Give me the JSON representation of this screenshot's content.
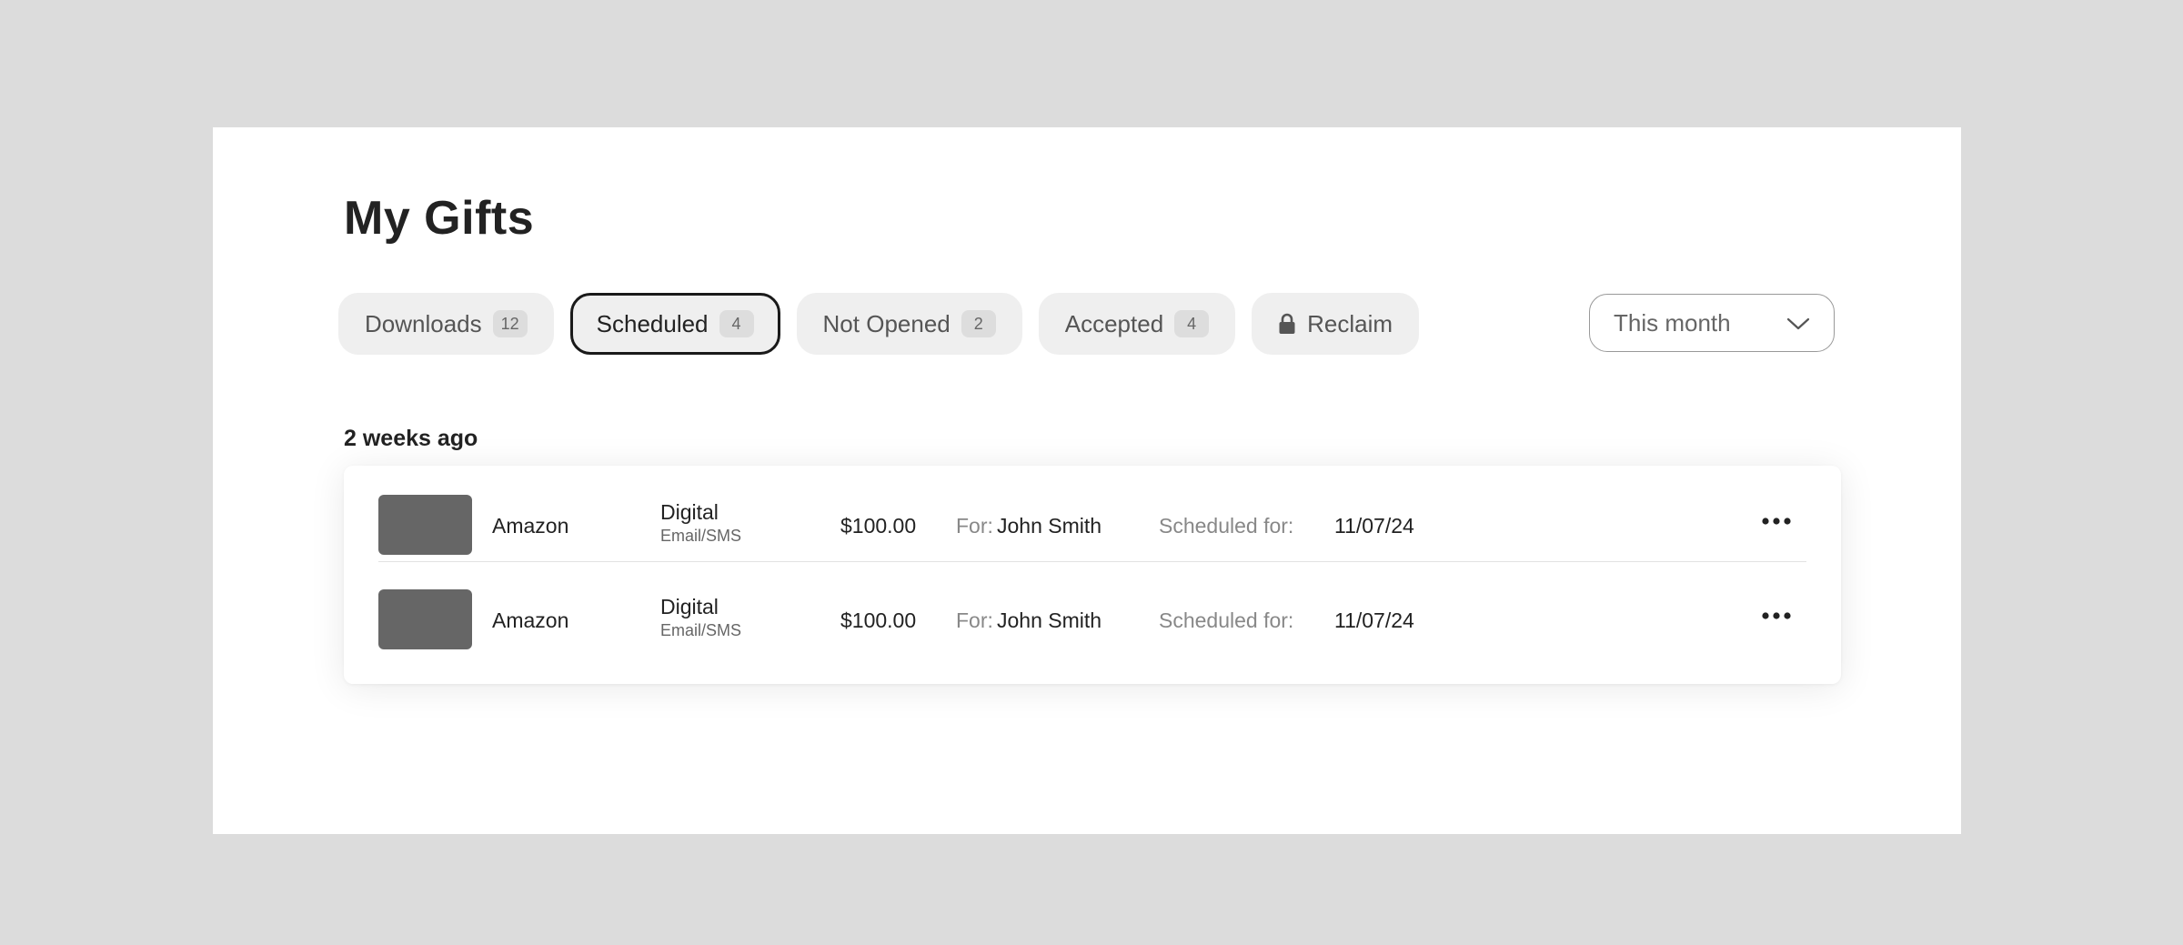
{
  "page": {
    "title": "My Gifts"
  },
  "tabs": [
    {
      "label": "Downloads",
      "count": "12",
      "active": false
    },
    {
      "label": "Scheduled",
      "count": "4",
      "active": true
    },
    {
      "label": "Not Opened",
      "count": "2",
      "active": false
    },
    {
      "label": "Accepted",
      "count": "4",
      "active": false
    },
    {
      "label": "Reclaim",
      "icon": "lock-icon",
      "active": false
    }
  ],
  "filter": {
    "selected": "This month",
    "icon": "chevron-down-icon"
  },
  "section": {
    "label": "2 weeks ago"
  },
  "gifts": [
    {
      "brand": "Amazon",
      "type": "Digital",
      "delivery": "Email/SMS",
      "amount": "$100.00",
      "for_label": "For:",
      "recipient": "John Smith",
      "scheduled_label": "Scheduled for:",
      "scheduled_date": "11/07/24"
    },
    {
      "brand": "Amazon",
      "type": "Digital",
      "delivery": "Email/SMS",
      "amount": "$100.00",
      "for_label": "For:",
      "recipient": "John Smith",
      "scheduled_label": "Scheduled for:",
      "scheduled_date": "11/07/24"
    }
  ],
  "colors": {
    "background": "#dcdcdc",
    "panel": "#ffffff",
    "tab_bg": "#efefef",
    "active_border": "#1a1a1a",
    "thumbnail": "#666666"
  }
}
